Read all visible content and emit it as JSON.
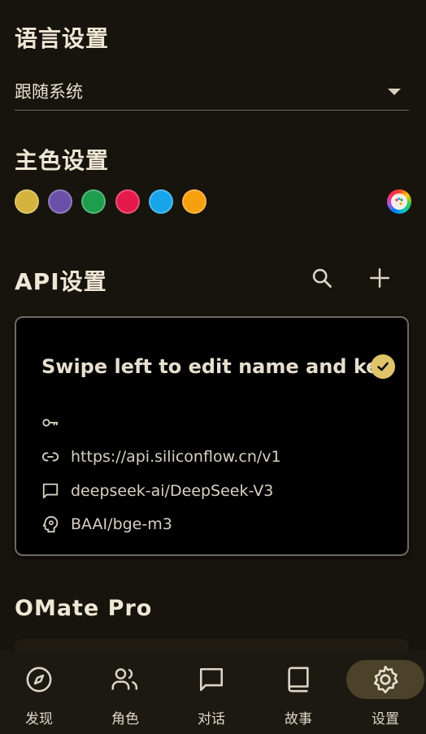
{
  "language": {
    "title": "语言设置",
    "selected": "跟随系统"
  },
  "theme": {
    "title": "主色设置",
    "swatches": [
      {
        "name": "yellow",
        "color": "#d4b33e"
      },
      {
        "name": "purple",
        "color": "#6b4fa8"
      },
      {
        "name": "green",
        "color": "#1e9e4c"
      },
      {
        "name": "red",
        "color": "#e5194b"
      },
      {
        "name": "blue",
        "color": "#17a4e8"
      },
      {
        "name": "orange",
        "color": "#f6a00e"
      }
    ],
    "picker_icon": "palette-icon"
  },
  "api": {
    "title": "API设置",
    "search_icon": "search-icon",
    "add_icon": "plus-icon",
    "card": {
      "title": "Swipe left to edit name and key",
      "selected_icon": "check-circle-icon",
      "key": "",
      "url": "https://api.siliconflow.cn/v1",
      "model": "deepseek-ai/DeepSeek-V3",
      "embedding": "BAAI/bge-m3"
    }
  },
  "pro": {
    "title": "OMate Pro"
  },
  "nav": {
    "items": [
      {
        "label": "发现",
        "icon": "compass-icon"
      },
      {
        "label": "角色",
        "icon": "people-icon"
      },
      {
        "label": "对话",
        "icon": "chat-bubble-icon"
      },
      {
        "label": "故事",
        "icon": "book-icon"
      },
      {
        "label": "设置",
        "icon": "gear-icon"
      }
    ],
    "active": "设置"
  }
}
